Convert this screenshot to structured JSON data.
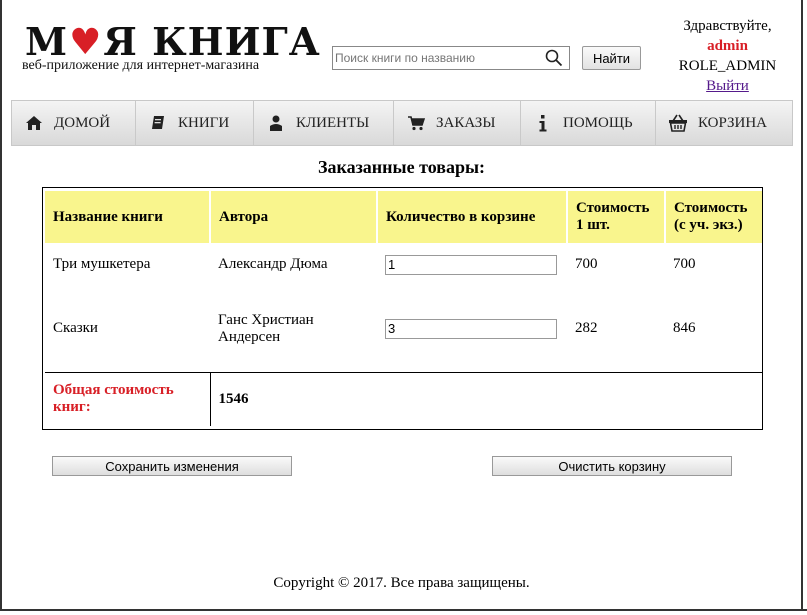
{
  "logo": {
    "title_part1": "М",
    "title_part2": "Я КНИГА",
    "heart": "♥",
    "subtitle": "веб-приложение для интернет-магазина"
  },
  "search": {
    "placeholder": "Поиск книги по названию",
    "button": "Найти"
  },
  "user": {
    "greeting": "Здравствуйте,",
    "name": "admin",
    "role": "ROLE_ADMIN",
    "logout": "Выйти"
  },
  "nav": [
    {
      "label": "ДОМОЙ",
      "icon": "home-icon"
    },
    {
      "label": "КНИГИ",
      "icon": "book-icon"
    },
    {
      "label": "КЛИЕНТЫ",
      "icon": "user-icon"
    },
    {
      "label": "ЗАКАЗЫ",
      "icon": "cart-icon"
    },
    {
      "label": "ПОМОЩЬ",
      "icon": "info-icon"
    },
    {
      "label": "КОРЗИНА",
      "icon": "basket-icon"
    }
  ],
  "page_title": "Заказанные товары:",
  "table": {
    "headers": [
      "Название книги",
      "Автора",
      "Количество в корзине",
      "Стоимость 1 шт.",
      "Стоимость (с уч. экз.)"
    ],
    "rows": [
      {
        "name": "Три мушкетера",
        "author": "Александр Дюма",
        "qty": "1",
        "price": "700",
        "total": "700"
      },
      {
        "name": "Сказки",
        "author": "Ганс Христиан Андерсен",
        "qty": "3",
        "price": "282",
        "total": "846"
      }
    ],
    "total_label": "Общая стоимость книг:",
    "total_value": "1546"
  },
  "buttons": {
    "save": "Сохранить изменения",
    "clear": "Очистить корзину"
  },
  "footer": "Copyright © 2017. Все права защищены.",
  "colors": {
    "accent": "#d81f26",
    "header_bg": "#f9f58d",
    "link": "#551a8b"
  }
}
